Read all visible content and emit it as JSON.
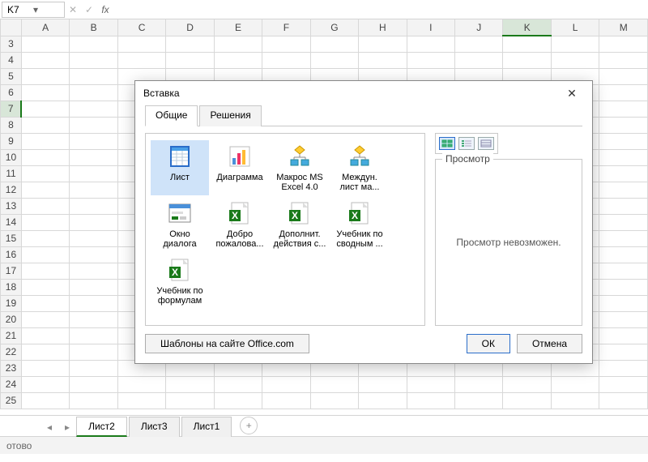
{
  "nameBox": "K7",
  "columns": [
    "A",
    "B",
    "C",
    "D",
    "E",
    "F",
    "G",
    "H",
    "I",
    "J",
    "K",
    "L",
    "M"
  ],
  "rowStart": 3,
  "rowEnd": 25,
  "selected": {
    "col": "K",
    "row": 7
  },
  "sheets": [
    {
      "label": "Лист2",
      "active": true
    },
    {
      "label": "Лист3",
      "active": false
    },
    {
      "label": "Лист1",
      "active": false
    }
  ],
  "status": "отово",
  "dialog": {
    "title": "Вставка",
    "tabs": [
      {
        "label": "Общие",
        "active": true
      },
      {
        "label": "Решения",
        "active": false
      }
    ],
    "templates": [
      {
        "key": "sheet",
        "label": "Лист",
        "icon": "excel-sheet",
        "selected": true
      },
      {
        "key": "chart",
        "label": "Диаграмма",
        "icon": "chart"
      },
      {
        "key": "macro",
        "label": "Макрос MS Excel 4.0",
        "icon": "flowchart"
      },
      {
        "key": "intl",
        "label": "Междун. лист ма...",
        "icon": "flowchart-alt"
      },
      {
        "key": "dlg",
        "label": "Окно диалога Exc...",
        "icon": "dialog-box"
      },
      {
        "key": "welcome",
        "label": "Добро пожалова...",
        "icon": "excel-doc"
      },
      {
        "key": "addon",
        "label": "Дополнит. действия с...",
        "icon": "excel-doc"
      },
      {
        "key": "pivot",
        "label": "Учебник по сводным ...",
        "icon": "excel-doc"
      },
      {
        "key": "formulas",
        "label": "Учебник по формулам",
        "icon": "excel-doc"
      }
    ],
    "preview": {
      "title": "Просмотр",
      "body": "Просмотр невозможен."
    },
    "buttons": {
      "templates": "Шаблоны на сайте Office.com",
      "ok": "ОК",
      "cancel": "Отмена"
    }
  }
}
